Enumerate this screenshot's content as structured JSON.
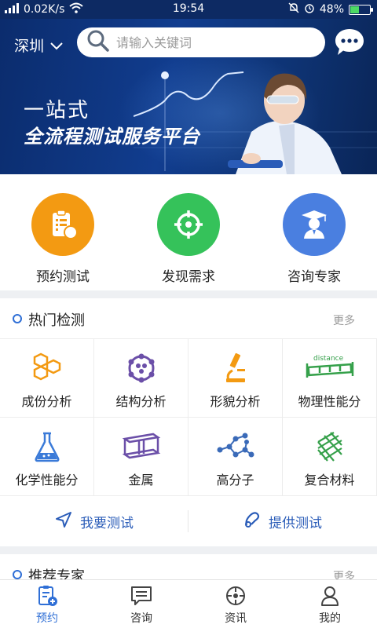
{
  "status_bar": {
    "network_speed": "0.02K/s",
    "time": "19:54",
    "battery": "48%",
    "battery_level": 0.48
  },
  "header": {
    "city": "深圳",
    "search_placeholder": "请输入关键词"
  },
  "banner": {
    "slogan_line1": "一站式",
    "slogan_line2": "全流程测试服务平台"
  },
  "quick_actions": [
    {
      "label": "预约测试",
      "icon": "clipboard-icon",
      "color": "#f39a12"
    },
    {
      "label": "发现需求",
      "icon": "target-icon",
      "color": "#35c25a"
    },
    {
      "label": "咨询专家",
      "icon": "expert-icon",
      "color": "#4a7fe0"
    }
  ],
  "hot_tests": {
    "title": "热门检测",
    "more": "更多",
    "items": [
      {
        "label": "成份分析",
        "icon": "honeycomb-icon"
      },
      {
        "label": "结构分析",
        "icon": "molecule-ring-icon"
      },
      {
        "label": "形貌分析",
        "icon": "microscope-icon"
      },
      {
        "label": "物理性能分",
        "icon": "distance-ruler-icon",
        "icon_text": "distance"
      },
      {
        "label": "化学性能分",
        "icon": "flask-icon"
      },
      {
        "label": "金属",
        "icon": "metal-beam-icon"
      },
      {
        "label": "高分子",
        "icon": "polymer-icon"
      },
      {
        "label": "复合材料",
        "icon": "mesh-icon"
      }
    ],
    "actions": [
      {
        "label": "我要测试",
        "icon": "navigation-arrow-icon"
      },
      {
        "label": "提供测试",
        "icon": "provide-icon"
      }
    ]
  },
  "recommended": {
    "title": "推荐专家",
    "more": "更多"
  },
  "tab_bar": [
    {
      "label": "预约",
      "icon": "booking-icon",
      "active": true
    },
    {
      "label": "咨询",
      "icon": "chat-icon",
      "active": false
    },
    {
      "label": "资讯",
      "icon": "news-icon",
      "active": false
    },
    {
      "label": "我的",
      "icon": "profile-icon",
      "active": false
    }
  ],
  "colors": {
    "primary": "#2f6fd6",
    "banner_dark": "#0b2c6d",
    "orange": "#f39a12",
    "green": "#35c25a",
    "blue": "#4a7fe0"
  }
}
